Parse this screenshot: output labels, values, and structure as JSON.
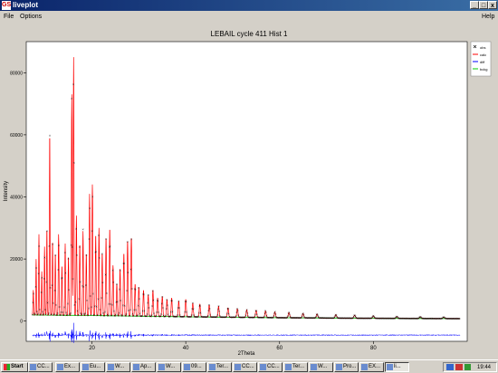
{
  "window": {
    "title": "liveplot",
    "app_icon": "GS",
    "minimize": "_",
    "maximize": "□",
    "close": "x"
  },
  "menu": {
    "file": "File",
    "options": "Options",
    "help": "Help"
  },
  "plot": {
    "title": "LEBAIL cycle 411 Hist 1",
    "xlabel": "2Theta",
    "ylabel": "Intensity",
    "xticks": [
      "20",
      "40",
      "60",
      "80"
    ],
    "yticks": [
      "0",
      "20000",
      "40000",
      "60000",
      "80000"
    ],
    "legend": [
      {
        "label": "obs",
        "color": "#000000"
      },
      {
        "label": "calc",
        "color": "#ff0000"
      },
      {
        "label": "diff",
        "color": "#0000ff"
      },
      {
        "label": "bckg",
        "color": "#00cc00"
      }
    ]
  },
  "chart_data": {
    "type": "line",
    "title": "LEBAIL cycle 411 Hist 1",
    "xlabel": "2Theta",
    "ylabel": "Intensity",
    "xlim": [
      6,
      100
    ],
    "ylim": [
      -6500,
      90000
    ],
    "grid": false,
    "legend_position": "right",
    "background": {
      "x": [
        6,
        20,
        40,
        60,
        80,
        99
      ],
      "y": [
        2000,
        1800,
        1400,
        1100,
        900,
        800
      ]
    },
    "diff_offset": -4500,
    "peaks": [
      {
        "x": 7.5,
        "y": 10000
      },
      {
        "x": 8.1,
        "y": 20000
      },
      {
        "x": 8.7,
        "y": 28000
      },
      {
        "x": 9.3,
        "y": 16000
      },
      {
        "x": 9.9,
        "y": 24000
      },
      {
        "x": 10.4,
        "y": 30000
      },
      {
        "x": 11.0,
        "y": 61000
      },
      {
        "x": 11.6,
        "y": 26000
      },
      {
        "x": 12.2,
        "y": 22000
      },
      {
        "x": 12.9,
        "y": 28000
      },
      {
        "x": 13.6,
        "y": 18000
      },
      {
        "x": 14.3,
        "y": 25000
      },
      {
        "x": 15.0,
        "y": 21000
      },
      {
        "x": 15.7,
        "y": 73000
      },
      {
        "x": 16.1,
        "y": 85000
      },
      {
        "x": 16.7,
        "y": 34000
      },
      {
        "x": 17.4,
        "y": 25000
      },
      {
        "x": 18.1,
        "y": 29000
      },
      {
        "x": 18.8,
        "y": 22000
      },
      {
        "x": 19.5,
        "y": 41000
      },
      {
        "x": 20.1,
        "y": 44000
      },
      {
        "x": 20.8,
        "y": 28000
      },
      {
        "x": 21.5,
        "y": 30000
      },
      {
        "x": 22.2,
        "y": 22000
      },
      {
        "x": 23.0,
        "y": 27000
      },
      {
        "x": 23.8,
        "y": 30000
      },
      {
        "x": 24.5,
        "y": 18000
      },
      {
        "x": 25.3,
        "y": 12000
      },
      {
        "x": 26.0,
        "y": 17000
      },
      {
        "x": 26.8,
        "y": 22000
      },
      {
        "x": 27.6,
        "y": 26000
      },
      {
        "x": 28.4,
        "y": 27000
      },
      {
        "x": 29.2,
        "y": 12000
      },
      {
        "x": 30.0,
        "y": 11000
      },
      {
        "x": 31.0,
        "y": 10000
      },
      {
        "x": 32.0,
        "y": 8500
      },
      {
        "x": 33.0,
        "y": 10000
      },
      {
        "x": 34.0,
        "y": 7500
      },
      {
        "x": 35.0,
        "y": 8000
      },
      {
        "x": 36.0,
        "y": 7000
      },
      {
        "x": 37.0,
        "y": 7500
      },
      {
        "x": 38.5,
        "y": 6500
      },
      {
        "x": 40.0,
        "y": 7000
      },
      {
        "x": 41.5,
        "y": 5800
      },
      {
        "x": 43.0,
        "y": 5500
      },
      {
        "x": 45.0,
        "y": 5200
      },
      {
        "x": 47.0,
        "y": 4800
      },
      {
        "x": 49.0,
        "y": 4300
      },
      {
        "x": 51.0,
        "y": 4000
      },
      {
        "x": 53.0,
        "y": 3700
      },
      {
        "x": 55.0,
        "y": 3500
      },
      {
        "x": 57.0,
        "y": 3300
      },
      {
        "x": 59.0,
        "y": 3000
      },
      {
        "x": 62.0,
        "y": 2800
      },
      {
        "x": 65.0,
        "y": 2500
      },
      {
        "x": 68.0,
        "y": 2300
      },
      {
        "x": 72.0,
        "y": 2100
      },
      {
        "x": 76.0,
        "y": 1900
      },
      {
        "x": 80.0,
        "y": 1700
      },
      {
        "x": 85.0,
        "y": 1500
      },
      {
        "x": 90.0,
        "y": 1400
      },
      {
        "x": 95.0,
        "y": 1300
      }
    ]
  },
  "taskbar": {
    "start": "Start",
    "buttons": [
      "CC...",
      "Ex...",
      "Eu...",
      "W...",
      "Ap...",
      "W...",
      "09...",
      "Ter...",
      "CC...",
      "CC...",
      "Ter...",
      "W...",
      "Pro...",
      "EX...",
      "li..."
    ],
    "clock": "19:44"
  }
}
